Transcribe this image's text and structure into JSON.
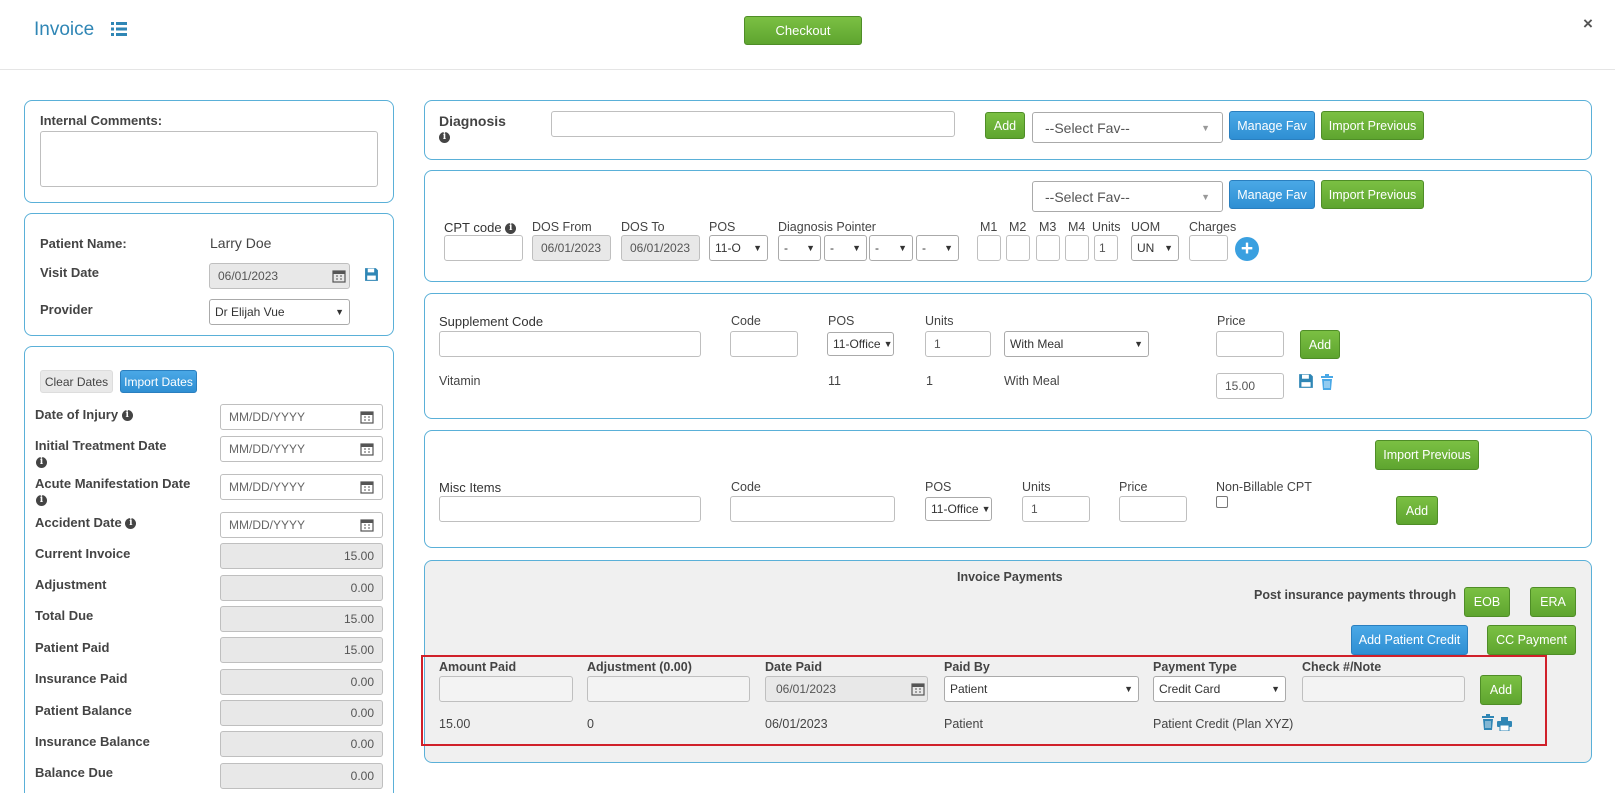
{
  "header": {
    "title": "Invoice",
    "checkout_label": "Checkout",
    "close_label": "×"
  },
  "comments": {
    "label": "Internal Comments:",
    "value": ""
  },
  "patient": {
    "name_label": "Patient Name:",
    "name_value": "Larry Doe",
    "visit_label": "Visit Date",
    "visit_value": "06/01/2023",
    "provider_label": "Provider",
    "provider_value": "Dr Elijah Vue"
  },
  "dates": {
    "clear_label": "Clear Dates",
    "import_label": "Import Dates",
    "placeholder": "MM/DD/YYYY",
    "injury_label": "Date of Injury",
    "initial_label": "Initial Treatment Date",
    "acute_label": "Acute Manifestation Date",
    "accident_label": "Accident Date"
  },
  "totals": [
    {
      "label": "Current Invoice",
      "value": "15.00"
    },
    {
      "label": "Adjustment",
      "value": "0.00"
    },
    {
      "label": "Total Due",
      "value": "15.00"
    },
    {
      "label": "Patient Paid",
      "value": "15.00"
    },
    {
      "label": "Insurance Paid",
      "value": "0.00"
    },
    {
      "label": "Patient Balance",
      "value": "0.00"
    },
    {
      "label": "Insurance Balance",
      "value": "0.00"
    },
    {
      "label": "Balance Due",
      "value": "0.00"
    }
  ],
  "diagnosis": {
    "label": "Diagnosis",
    "add_label": "Add",
    "fav_placeholder": "--Select Fav--",
    "manage_fav_label": "Manage Fav",
    "import_previous_label": "Import Previous"
  },
  "cpt": {
    "fav_placeholder": "--Select Fav--",
    "manage_fav_label": "Manage Fav",
    "import_previous_label": "Import Previous",
    "cpt_label": "CPT code",
    "dos_from_label": "DOS From",
    "dos_from_value": "06/01/2023",
    "dos_to_label": "DOS To",
    "dos_to_value": "06/01/2023",
    "pos_label": "POS",
    "pos_value": "11-O",
    "pointer_label": "Diagnosis Pointer",
    "pointer_value": "-",
    "m1": "M1",
    "m2": "M2",
    "m3": "M3",
    "m4": "M4",
    "units_label": "Units",
    "units_value": "1",
    "uom_label": "UOM",
    "uom_value": "UN",
    "charges_label": "Charges"
  },
  "supplement": {
    "code_label": "Supplement Code",
    "code2_label": "Code",
    "pos_label": "POS",
    "pos_value": "11-Office",
    "units_label": "Units",
    "units_value": "1",
    "meal_value": "With Meal",
    "price_label": "Price",
    "add_label": "Add",
    "row": {
      "name": "Vitamin",
      "pos": "11",
      "units": "1",
      "meal": "With Meal",
      "price": "15.00"
    }
  },
  "misc": {
    "import_previous_label": "Import Previous",
    "items_label": "Misc Items",
    "code_label": "Code",
    "pos_label": "POS",
    "pos_value": "11-Office",
    "units_label": "Units",
    "units_value": "1",
    "price_label": "Price",
    "nonbillable_label": "Non-Billable CPT",
    "add_label": "Add"
  },
  "payments": {
    "title": "Invoice Payments",
    "post_label": "Post insurance payments through",
    "eob_label": "EOB",
    "era_label": "ERA",
    "add_credit_label": "Add Patient Credit",
    "cc_payment_label": "CC Payment",
    "amount_label": "Amount Paid",
    "adjustment_label": "Adjustment (0.00)",
    "date_label": "Date Paid",
    "date_value": "06/01/2023",
    "paid_by_label": "Paid By",
    "paid_by_value": "Patient",
    "type_label": "Payment Type",
    "type_value": "Credit Card",
    "check_label": "Check #/Note",
    "add_label": "Add",
    "row": {
      "amount": "15.00",
      "adjustment": "0",
      "date": "06/01/2023",
      "paid_by": "Patient",
      "type": "Patient Credit (Plan XYZ)"
    }
  },
  "colors": {
    "accent": "#2f86b5",
    "green": "#6ab23a",
    "blue": "#3a9ad9",
    "highlight": "#d0202a"
  }
}
